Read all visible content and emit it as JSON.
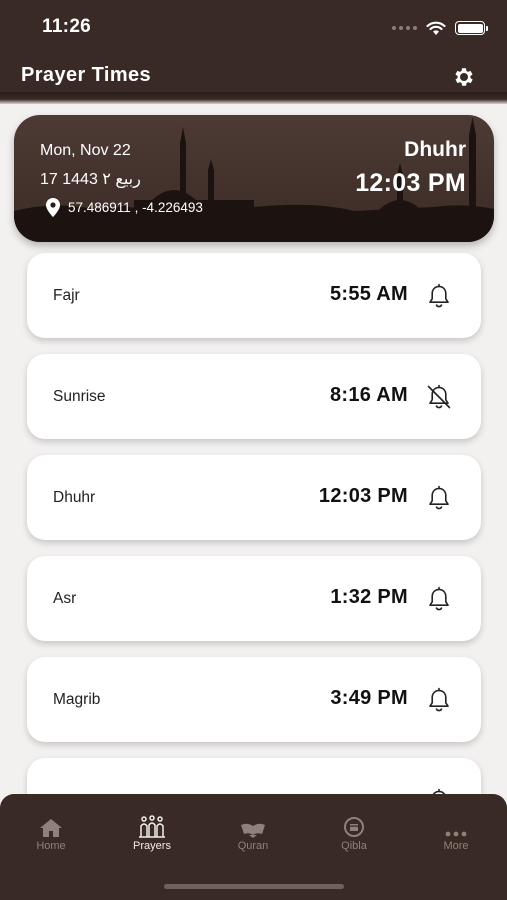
{
  "status_bar": {
    "time": "11:26"
  },
  "header": {
    "title": "Prayer Times",
    "settings_icon": "gear-icon"
  },
  "current": {
    "date": "Mon, Nov 22",
    "hijri": "17 ربيع ٢ 1443",
    "location": "57.486911 , -4.226493",
    "prayer": "Dhuhr",
    "time": "12:03 PM"
  },
  "prayers": [
    {
      "name": "Fajr",
      "time": "5:55 AM",
      "notification": "on"
    },
    {
      "name": "Sunrise",
      "time": "8:16 AM",
      "notification": "off"
    },
    {
      "name": "Dhuhr",
      "time": "12:03 PM",
      "notification": "on"
    },
    {
      "name": "Asr",
      "time": "1:32 PM",
      "notification": "on"
    },
    {
      "name": "Magrib",
      "time": "3:49 PM",
      "notification": "on"
    }
  ],
  "nav": [
    {
      "label": "Home",
      "icon": "home-icon",
      "active": false
    },
    {
      "label": "Prayers",
      "icon": "prayers-icon",
      "active": true
    },
    {
      "label": "Quran",
      "icon": "quran-icon",
      "active": false
    },
    {
      "label": "Qibla",
      "icon": "qibla-icon",
      "active": false
    },
    {
      "label": "More",
      "icon": "more-icon",
      "active": false
    }
  ],
  "colors": {
    "brand_dark": "#3a2a25",
    "background": "#f3f1f0",
    "inactive_nav": "#8e807b"
  }
}
